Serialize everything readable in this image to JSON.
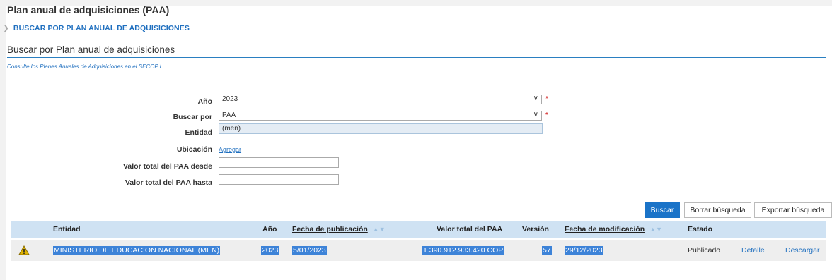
{
  "page": {
    "title": "Plan anual de adquisiciones (PAA)"
  },
  "breadcrumb": {
    "label": "BUSCAR POR PLAN ANUAL DE ADQUISICIONES"
  },
  "section": {
    "title": "Buscar por Plan anual de adquisiciones",
    "note": "Consulte los Planes Anuales de Adquisiciones en el SECOP I"
  },
  "form": {
    "year_label": "Año",
    "year_value": "2023",
    "search_by_label": "Buscar por",
    "search_by_value": "PAA",
    "entity_label": "Entidad",
    "entity_value": "(men)",
    "location_label": "Ubicación",
    "location_link": "Agregar",
    "min_label": "Valor total del PAA desde",
    "min_value": "",
    "max_label": "Valor total del PAA hasta",
    "max_value": "",
    "required_mark": "*"
  },
  "buttons": {
    "search": "Buscar",
    "clear": "Borrar búsqueda",
    "export": "Exportar búsqueda"
  },
  "table": {
    "headers": {
      "entity": "Entidad",
      "year": "Año",
      "pub_date": "Fecha de publicación",
      "total": "Valor total del PAA",
      "version": "Versión",
      "mod_date": "Fecha de modificación",
      "status": "Estado"
    },
    "rows": [
      {
        "entity": "MINISTERIO DE EDUCACION NACIONAL (MEN)",
        "year": "2023",
        "pub_date": "5/01/2023",
        "total": "1.390.912.933.420 COP",
        "version": "57",
        "mod_date": "29/12/2023",
        "status": "Publicado",
        "detail": "Detalle",
        "download": "Descargar",
        "icon": "warning-icon"
      }
    ]
  },
  "colors": {
    "accent": "#1a73c8",
    "header_bg": "#cfe2f3",
    "selection": "#3d83d8",
    "warning": "#e0b400"
  }
}
